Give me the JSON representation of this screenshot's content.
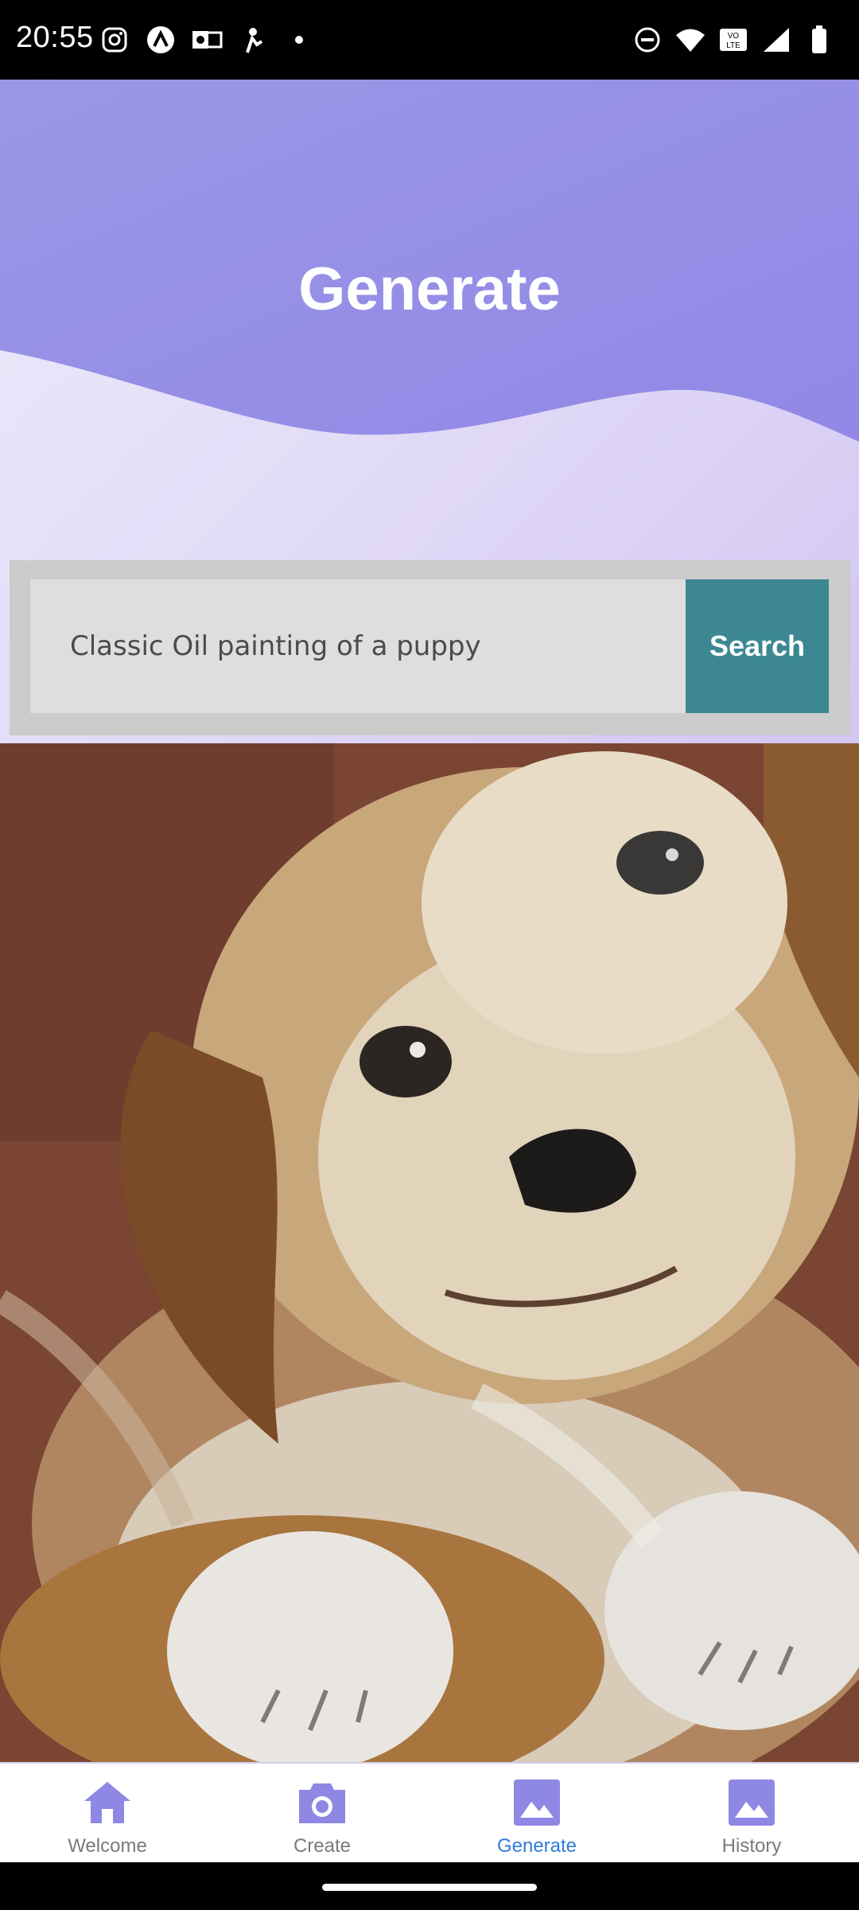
{
  "status_bar": {
    "time": "20:55",
    "left_icons": [
      "instagram-icon",
      "app-icon",
      "outlook-icon",
      "notification-icon"
    ],
    "right_icons": [
      "dnd-icon",
      "wifi-icon",
      "volte-icon",
      "signal-icon",
      "battery-icon"
    ]
  },
  "header": {
    "title": "Generate"
  },
  "search": {
    "value": "Classic Oil painting of a puppy",
    "button_label": "Search"
  },
  "result": {
    "image_alt": "painting-of-puppy"
  },
  "nav": {
    "items": [
      {
        "label": "Welcome",
        "icon": "home-icon"
      },
      {
        "label": "Create",
        "icon": "camera-icon"
      },
      {
        "label": "Generate",
        "icon": "image-icon",
        "active": true
      },
      {
        "label": "History",
        "icon": "image-icon"
      }
    ]
  },
  "colors": {
    "accent": "#9189e6",
    "active_nav": "#2f7cd6",
    "search_button": "#3c8792"
  }
}
